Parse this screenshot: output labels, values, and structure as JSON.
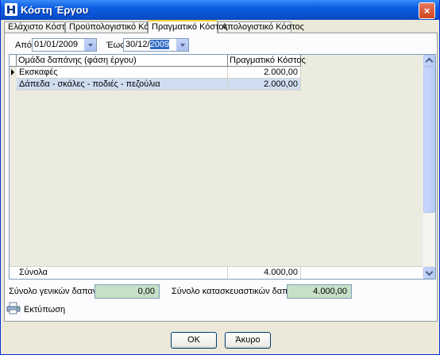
{
  "window": {
    "title": "Κόστη Έργου",
    "close_symbol": "×"
  },
  "tabs": [
    {
      "label": "Ελάχιστο Κόστος"
    },
    {
      "label": "Προϋπολογιστικό Κόστος"
    },
    {
      "label": "Πραγματικό Κόστος",
      "active": true
    },
    {
      "label": "Απολογιστικό Κόστος"
    }
  ],
  "filters": {
    "from_label": "Από",
    "from_value": "01/01/2009",
    "to_label": "Έως",
    "to_value_prefix": "30/12/",
    "to_value_selected": "2009"
  },
  "grid": {
    "columns": [
      "Ομάδα δαπάνης (φάση έργου)",
      "Πραγματικό Κόστος"
    ],
    "rows": [
      {
        "group": "Εκσκαφές",
        "cost": "2.000,00"
      },
      {
        "group": "Δάπεδα - σκάλες - ποδιές - πεζούλια",
        "cost": "2.000,00"
      }
    ],
    "footer": {
      "label": "Σύνολα",
      "total": "4.000,00"
    }
  },
  "totals": {
    "general_label": "Σύνολο γενικών δαπανών",
    "general_value": "0,00",
    "construction_label": "Σύνολο κατασκευαστικών δαπανών",
    "construction_value": "4.000,00"
  },
  "actions": {
    "print": "Εκτύπωση",
    "ok": "OK",
    "cancel": "Άκυρο"
  },
  "colors": {
    "title_bar": "#0a54d4",
    "total_box": "#c6e0c6",
    "selected_row": "#d0def2"
  }
}
